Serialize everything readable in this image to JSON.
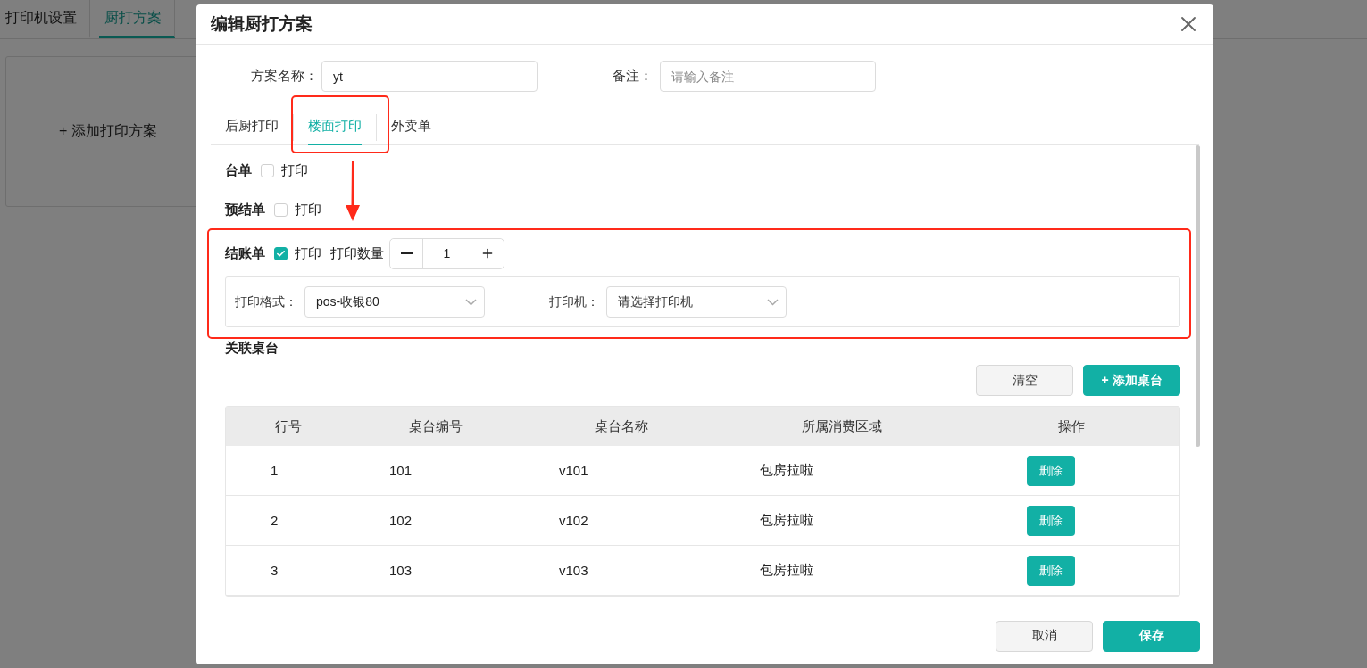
{
  "background": {
    "tabs": [
      {
        "label": "打印机设置",
        "selected": false
      },
      {
        "label": "厨打方案",
        "selected": true
      }
    ],
    "add_card": {
      "label": "+ 添加打印方案"
    }
  },
  "dialog": {
    "title": "编辑厨打方案",
    "fields": [
      {
        "label": "方案名称：",
        "value": "yt"
      },
      {
        "label": "备注：",
        "placeholder": "请输入备注"
      }
    ],
    "tabs": [
      {
        "label": "后厨打印",
        "selected": false
      },
      {
        "label": "楼面打印",
        "selected": true
      },
      {
        "label": "外卖单",
        "selected": false
      }
    ],
    "print_options": [
      {
        "label": "台单",
        "checked": false,
        "print_label": "打印"
      },
      {
        "label": "预结单",
        "checked": false,
        "print_label": "打印"
      },
      {
        "label": "结账单",
        "checked": true,
        "print_label": "打印",
        "quantity_label": "打印数量",
        "quantity": "1",
        "settings": {
          "format_label": "打印格式：",
          "format_value": "pos-收银80",
          "printer_label": "打印机：",
          "printer_placeholder": "请选择打印机"
        }
      }
    ],
    "linked_tables": {
      "title": "关联桌台",
      "clear_button": "清空",
      "add_button": "+ 添加桌台",
      "columns": [
        "行号",
        "桌台编号",
        "桌台名称",
        "所属消费区域",
        "操作"
      ],
      "rows": [
        {
          "cells": [
            "1",
            "101",
            "v101",
            "包房拉啦"
          ],
          "action": "删除"
        },
        {
          "cells": [
            "2",
            "102",
            "v102",
            "包房拉啦"
          ],
          "action": "删除"
        },
        {
          "cells": [
            "3",
            "103",
            "v103",
            "包房拉啦"
          ],
          "action": "删除"
        }
      ]
    },
    "footer": {
      "cancel": "取消",
      "save": "保存"
    }
  }
}
